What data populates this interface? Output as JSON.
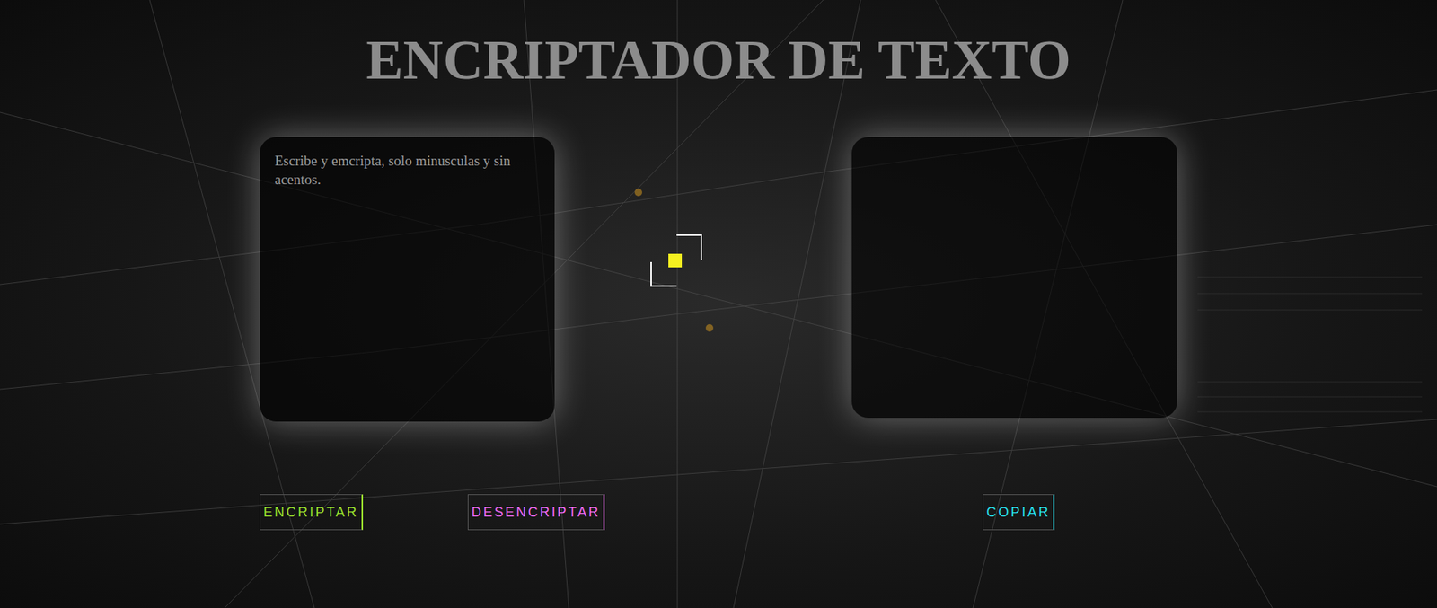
{
  "title": "ENCRIPTADOR DE TEXTO",
  "input": {
    "placeholder": "Escribe y emcripta, solo minusculas y sin acentos."
  },
  "input_buttons": [
    {
      "label": "ENCRIPTAR",
      "color": "#9be22d"
    },
    {
      "label": "DESENCRIPTAR",
      "color": "#f36bf6"
    }
  ],
  "output_buttons": [
    {
      "label": "COPIAR",
      "color": "#27e3f2"
    }
  ]
}
